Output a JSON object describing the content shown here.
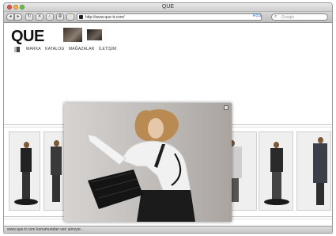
{
  "window": {
    "title": "QUE"
  },
  "toolbar": {
    "back_label": "◂",
    "forward_label": "▸",
    "reload_label": "↻",
    "stop_label": "✕",
    "home_label": "⌂",
    "bookmark_label": "⊕",
    "star_label": "☆",
    "url": "http://www.que-tr.com/",
    "rss_label": "RSS",
    "search_placeholder": "Google"
  },
  "site": {
    "logo": "QUE",
    "nav": [
      "MARKA",
      "KATALOG",
      "MAĞAZALAR",
      "İLETİŞİM"
    ]
  },
  "status": {
    "text": "www.que-tr.com konumundan veri alınıyor..."
  }
}
